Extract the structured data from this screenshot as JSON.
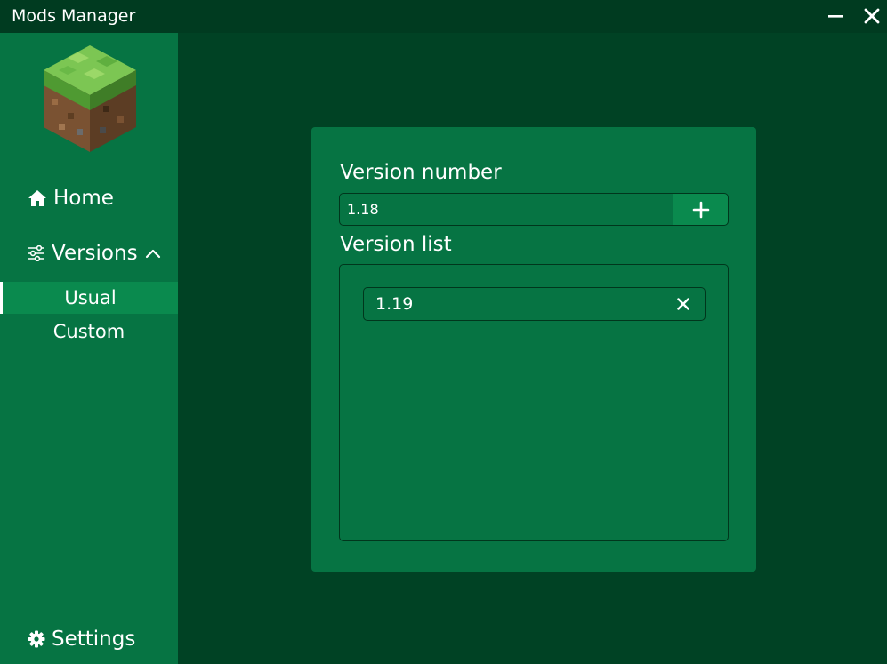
{
  "window": {
    "title": "Mods Manager",
    "minimize_icon": "minimize-icon",
    "close_icon": "close-icon"
  },
  "colors": {
    "titlebar": "#003b20",
    "background": "#004224",
    "sidebar": "#067443",
    "card": "#067443",
    "selected": "#0a8a4e",
    "border": "#00361c",
    "text": "#ffffff"
  },
  "sidebar": {
    "logo_icon": "grass-block-logo",
    "nav": {
      "home": {
        "label": "Home",
        "icon": "home-icon"
      },
      "versions": {
        "label": "Versions",
        "icon": "sliders-icon",
        "expanded_icon": "chevron-up-icon",
        "sub_items": [
          {
            "label": "Usual",
            "selected": true
          },
          {
            "label": "Custom",
            "selected": false
          }
        ]
      },
      "settings": {
        "label": "Settings",
        "icon": "gear-icon"
      }
    }
  },
  "main": {
    "version_number_label": "Version number",
    "version_input": {
      "value": "1.18",
      "placeholder": ""
    },
    "add_button_icon": "plus-icon",
    "version_list_label": "Version list",
    "version_list": [
      {
        "label": "1.19",
        "remove_icon": "close-icon"
      }
    ]
  }
}
